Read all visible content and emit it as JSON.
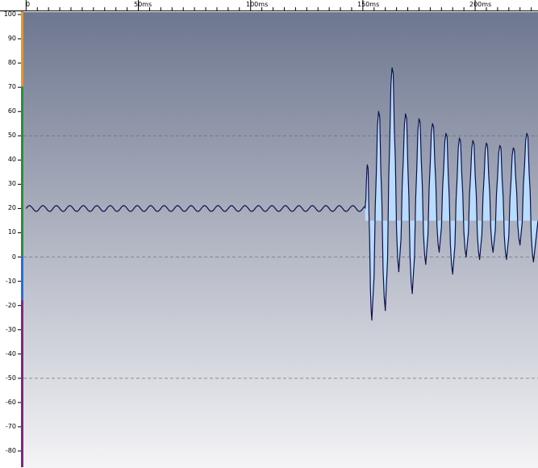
{
  "ruler": {
    "time_labels": [
      {
        "label": "0",
        "ms": 0
      },
      {
        "label": "50ms",
        "ms": 50
      },
      {
        "label": "100ms",
        "ms": 100
      },
      {
        "label": "150ms",
        "ms": 150
      },
      {
        "label": "200ms",
        "ms": 200
      }
    ]
  },
  "chart_data": {
    "type": "line",
    "xlabel": "",
    "ylabel": "",
    "xlim_ms": [
      -1.2,
      228
    ],
    "ylim": [
      -87,
      101
    ],
    "y_ticks": [
      100,
      90,
      80,
      70,
      60,
      50,
      40,
      30,
      20,
      10,
      0,
      -10,
      -20,
      -30,
      -40,
      -50,
      -60,
      -70,
      -80
    ],
    "dashed_gridlines": [
      50,
      0,
      -50
    ],
    "segments": [
      {
        "name": "idle",
        "from_ms": 0,
        "to_ms": 151,
        "baseline": 20,
        "amplitude": 1.2,
        "period_ms": 6
      },
      {
        "name": "burst",
        "from_ms": 151,
        "to_ms": 228,
        "baseline": 15
      }
    ],
    "burst_peaks": [
      {
        "ms": 152,
        "y": 38
      },
      {
        "ms": 154,
        "y": -26
      },
      {
        "ms": 157,
        "y": 60
      },
      {
        "ms": 160,
        "y": -22
      },
      {
        "ms": 163,
        "y": 78
      },
      {
        "ms": 166,
        "y": -6
      },
      {
        "ms": 169,
        "y": 59
      },
      {
        "ms": 172,
        "y": -15
      },
      {
        "ms": 175,
        "y": 57
      },
      {
        "ms": 178,
        "y": -3
      },
      {
        "ms": 181,
        "y": 55
      },
      {
        "ms": 184,
        "y": 2
      },
      {
        "ms": 187,
        "y": 51
      },
      {
        "ms": 190,
        "y": -7
      },
      {
        "ms": 193,
        "y": 49
      },
      {
        "ms": 196,
        "y": 0
      },
      {
        "ms": 199,
        "y": 48
      },
      {
        "ms": 202,
        "y": -1
      },
      {
        "ms": 205,
        "y": 47
      },
      {
        "ms": 208,
        "y": 2
      },
      {
        "ms": 211,
        "y": 46
      },
      {
        "ms": 214,
        "y": -1
      },
      {
        "ms": 217,
        "y": 45
      },
      {
        "ms": 220,
        "y": 5
      },
      {
        "ms": 223,
        "y": 51
      },
      {
        "ms": 226,
        "y": -2
      }
    ],
    "line_color": "#10104a",
    "fill_color": "#b8dcff",
    "background_top": "#6e7790",
    "background_bottom": "#f4f4f6",
    "range_bar_colors": [
      "#e8962a",
      "#2e8b3c",
      "#2a6ed2",
      "#7a2a7a"
    ]
  }
}
